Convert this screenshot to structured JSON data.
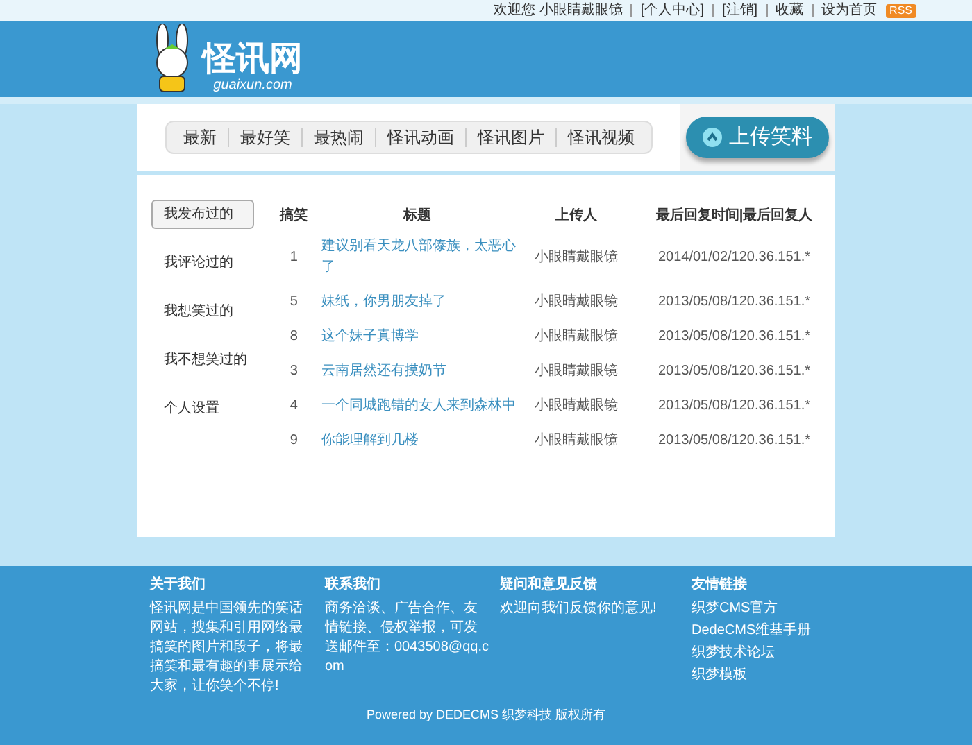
{
  "top_bar": {
    "welcome": "欢迎您 小眼睛戴眼镜",
    "links": [
      "[个人中心]",
      "[注销]",
      "收藏",
      "设为首页"
    ],
    "rss": "RSS"
  },
  "logo": {
    "name": "怪讯网",
    "domain": "guaixun.com"
  },
  "nav": {
    "items": [
      {
        "label": "最新"
      },
      {
        "label": "最好笑"
      },
      {
        "label": "最热闹"
      },
      {
        "label": "怪讯动画"
      },
      {
        "label": "怪讯图片"
      },
      {
        "label": "怪讯视频"
      }
    ],
    "upload": "上传笑料"
  },
  "sidebar": {
    "items": [
      {
        "label": "我发布过的",
        "selected": true
      },
      {
        "label": "我评论过的",
        "selected": false
      },
      {
        "label": "我想笑过的",
        "selected": false
      },
      {
        "label": "我不想笑过的",
        "selected": false
      },
      {
        "label": "个人设置",
        "selected": false
      }
    ]
  },
  "table": {
    "columns": [
      "搞笑",
      "标题",
      "上传人",
      "最后回复时间|最后回复人"
    ],
    "rows": [
      [
        "1",
        "建议别看天龙八部傣族，太恶心了",
        "小眼睛戴眼镜",
        "2014/01/02/120.36.151.*"
      ],
      [
        "5",
        "妹纸，你男朋友掉了",
        "小眼睛戴眼镜",
        "2013/05/08/120.36.151.*"
      ],
      [
        "8",
        "这个妹子真博学",
        "小眼睛戴眼镜",
        "2013/05/08/120.36.151.*"
      ],
      [
        "3",
        "云南居然还有摸奶节",
        "小眼睛戴眼镜",
        "2013/05/08/120.36.151.*"
      ],
      [
        "4",
        "一个同城跑错的女人来到森林中",
        "小眼睛戴眼镜",
        "2013/05/08/120.36.151.*"
      ],
      [
        "9",
        "你能理解到几楼",
        "小眼睛戴眼镜",
        "2013/05/08/120.36.151.*"
      ]
    ]
  },
  "footer": {
    "columns": [
      {
        "title": "关于我们",
        "lines": [
          "怪讯网是中国领先的笑话网站，搜集和引用网络最搞笑的图片和段子，将最搞笑和最有趣的事展示给大家，让你笑个不停!"
        ]
      },
      {
        "title": "联系我们",
        "lines": [
          "商务洽谈、广告合作、友情链接、侵权举报，可发送邮件至：0043508@qq.com"
        ]
      },
      {
        "title": "疑问和意见反馈",
        "lines": [
          "欢迎向我们反馈你的意见!"
        ]
      },
      {
        "title": "友情链接",
        "lines": [
          "织梦CMS官方",
          "DedeCMS维基手册",
          "织梦技术论坛",
          "织梦模板"
        ]
      }
    ],
    "powered": "Powered by DEDECMS 织梦科技 版权所有"
  }
}
